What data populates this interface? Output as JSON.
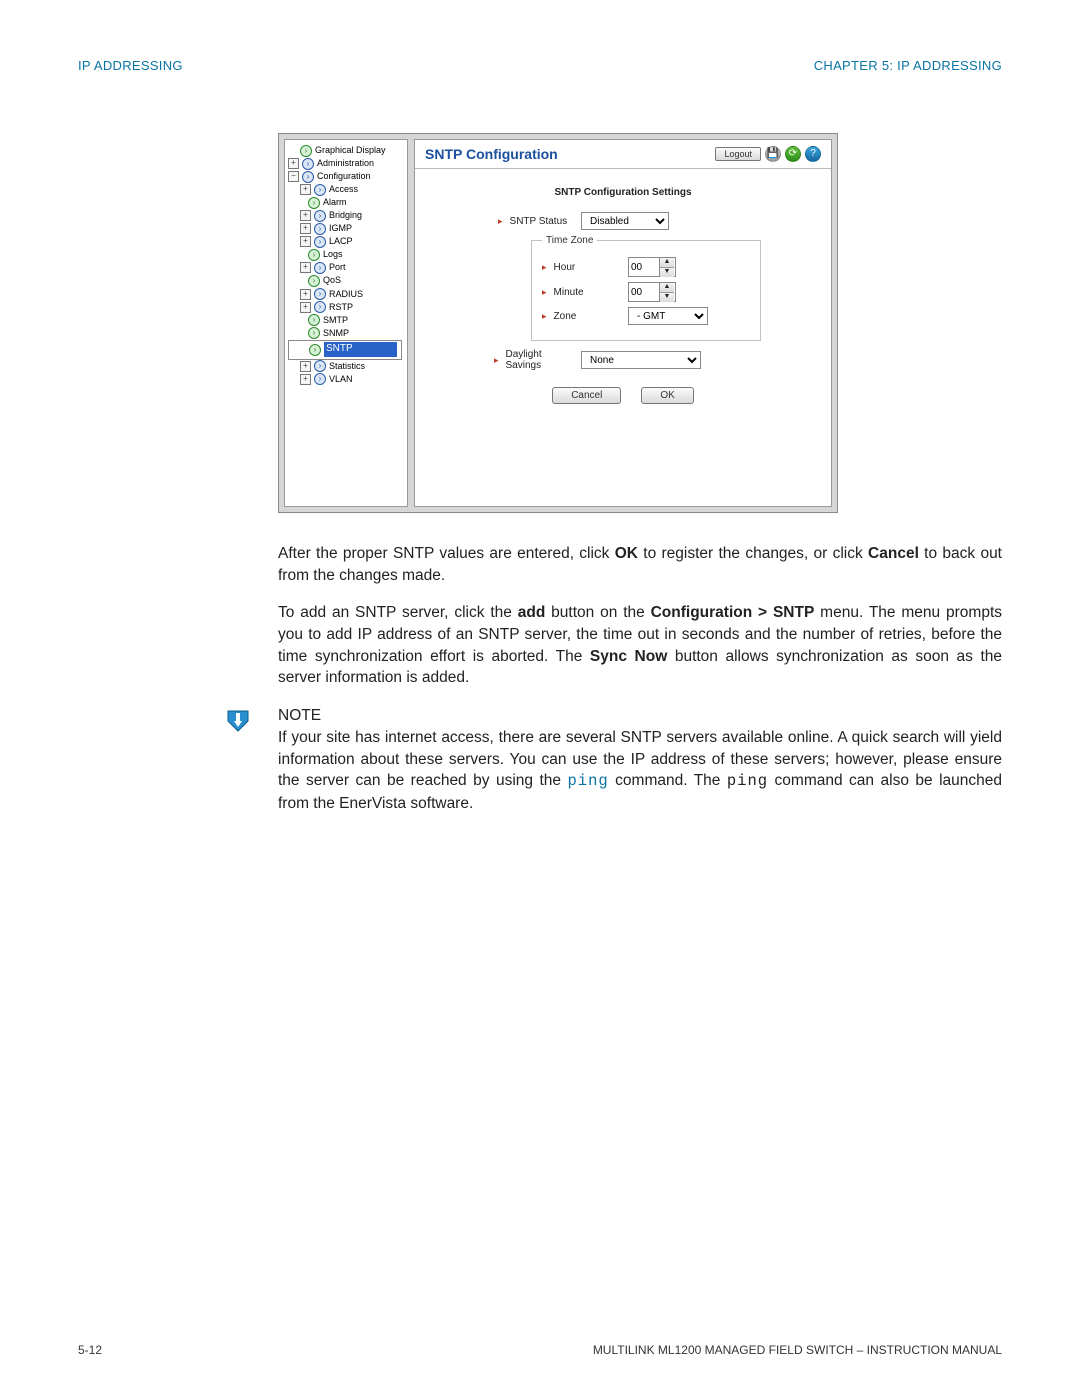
{
  "header": {
    "left": "IP ADDRESSING",
    "right": "CHAPTER 5:  IP ADDRESSING"
  },
  "footer": {
    "page": "5-12",
    "title": "MULTILINK ML1200 MANAGED FIELD SWITCH – INSTRUCTION MANUAL"
  },
  "nav": {
    "items": [
      {
        "label": "Graphical Display"
      },
      {
        "label": "Administration"
      },
      {
        "label": "Configuration"
      },
      {
        "label": "Access"
      },
      {
        "label": "Alarm"
      },
      {
        "label": "Bridging"
      },
      {
        "label": "IGMP"
      },
      {
        "label": "LACP"
      },
      {
        "label": "Logs"
      },
      {
        "label": "Port"
      },
      {
        "label": "QoS"
      },
      {
        "label": "RADIUS"
      },
      {
        "label": "RSTP"
      },
      {
        "label": "SMTP"
      },
      {
        "label": "SNMP"
      },
      {
        "label": "SNTP"
      },
      {
        "label": "Statistics"
      },
      {
        "label": "VLAN"
      }
    ]
  },
  "panel": {
    "title": "SNTP Configuration",
    "logout": "Logout",
    "section_title": "SNTP Configuration Settings",
    "sntp_status_label": "SNTP Status",
    "sntp_status_value": "Disabled",
    "tz_legend": "Time Zone",
    "hour_label": "Hour",
    "hour_value": "00",
    "minute_label": "Minute",
    "minute_value": "00",
    "zone_label": "Zone",
    "zone_value": "- GMT",
    "daylight_label": "Daylight Savings",
    "daylight_value": "None",
    "cancel": "Cancel",
    "ok": "OK"
  },
  "para1": {
    "t1": "After the proper SNTP values are entered, click ",
    "b1": "OK",
    "t2": " to register the changes, or click ",
    "b2": "Cancel",
    "t3": " to back out from the changes made."
  },
  "para2": {
    "t1": "To add an SNTP server, click the ",
    "b1": "add",
    "t2": " button on the ",
    "b2": "Configuration > SNTP",
    "t3": " menu. The menu prompts you to add IP address of an SNTP server, the time out in seconds and the number of retries, before the time synchronization effort is aborted. The ",
    "b3": "Sync Now",
    "t4": " button allows synchronization as soon as the server information is added."
  },
  "para3": {
    "t1": "If your site has internet access, there are several SNTP servers available online. A quick search will yield information about these servers. You can use the IP address of these servers; however, please ensure the server can be reached by using the ",
    "cmd": "ping",
    "t2": " command. The ",
    "cmd2": "ping",
    "t3": " command can also be launched from the EnerVista software."
  },
  "note_label": "NOTE"
}
